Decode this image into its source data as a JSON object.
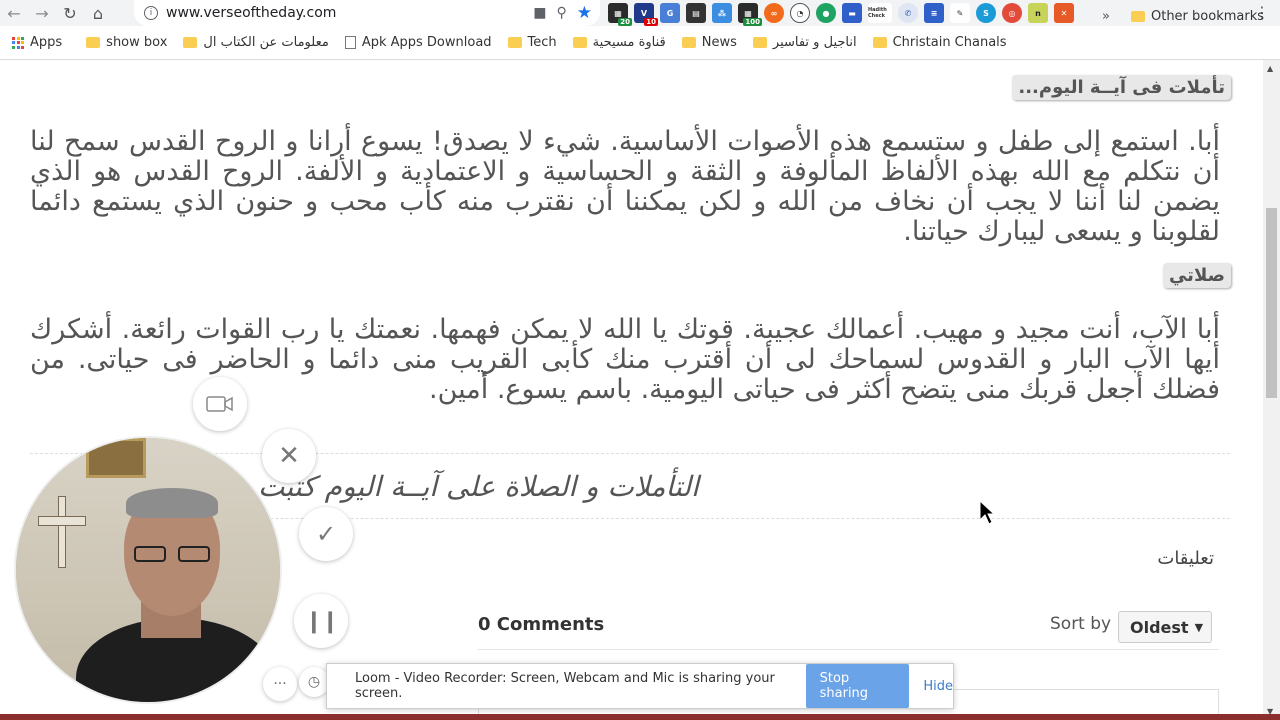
{
  "browser": {
    "url": "www.verseoftheday.com",
    "extension_badges": [
      "20",
      "10",
      "100"
    ],
    "extension_texts": [
      "Hadith Check"
    ]
  },
  "bookmarks": {
    "items": [
      {
        "label": "Apps",
        "type": "apps"
      },
      {
        "label": "show box",
        "type": "folder"
      },
      {
        "label": "معلومات عن الكتاب ال",
        "type": "folder"
      },
      {
        "label": "Apk Apps Download",
        "type": "page"
      },
      {
        "label": "Tech",
        "type": "folder"
      },
      {
        "label": "قناوة مسيحية",
        "type": "folder"
      },
      {
        "label": "News",
        "type": "folder"
      },
      {
        "label": "اناجيل و تفاسير",
        "type": "folder"
      },
      {
        "label": "Christain Chanals",
        "type": "folder"
      }
    ],
    "more": "»",
    "other": "Other bookmarks"
  },
  "page": {
    "reflection_label": "تأملات فى آيــة اليوم...",
    "reflection_text": "أبا. استمع إلى طفل و ستسمع هذه الأصوات الأساسية. شيء لا يصدق! يسوع أرانا و الروح القدس سمح لنا أن نتكلم مع الله بهذه الألفاظ المألوفة و الثقة و الحساسية و الاعتمادية و الألفة. الروح القدس هو الذي يضمن لنا أننا لا يجب أن نخاف من الله و لكن يمكننا أن نقترب منه كأب محب و حنون الذي يستمع دائما لقلوبنا و يسعى ليبارك حياتنا.",
    "prayer_label": "صلاتي",
    "prayer_text": "أبا الآب، أنت مجيد و مهيب. أعمالك عجيبة. قوتك يا الله لا يمكن فهمها. نعمتك يا رب القوات رائعة. أشكرك أيها الآب البار و القدوس لسماحك لى أن أقترب منك كأبى القريب منى دائما و الحاضر فى حياتى. من فضلك أجعل قربك منى يتضح أكثر فى حياتى اليومية. باسم يسوع. أمين.",
    "signature": "التأملات و الصلاة على آيــة اليوم كتبت",
    "comments_heading": "تعليقات",
    "comment_count": "0 Comments",
    "sort_label": "Sort by",
    "sort_value": "Oldest"
  },
  "loom": {
    "message": "Loom - Video Recorder: Screen, Webcam and Mic is sharing your screen.",
    "stop_label": "Stop sharing",
    "hide_label": "Hide"
  }
}
